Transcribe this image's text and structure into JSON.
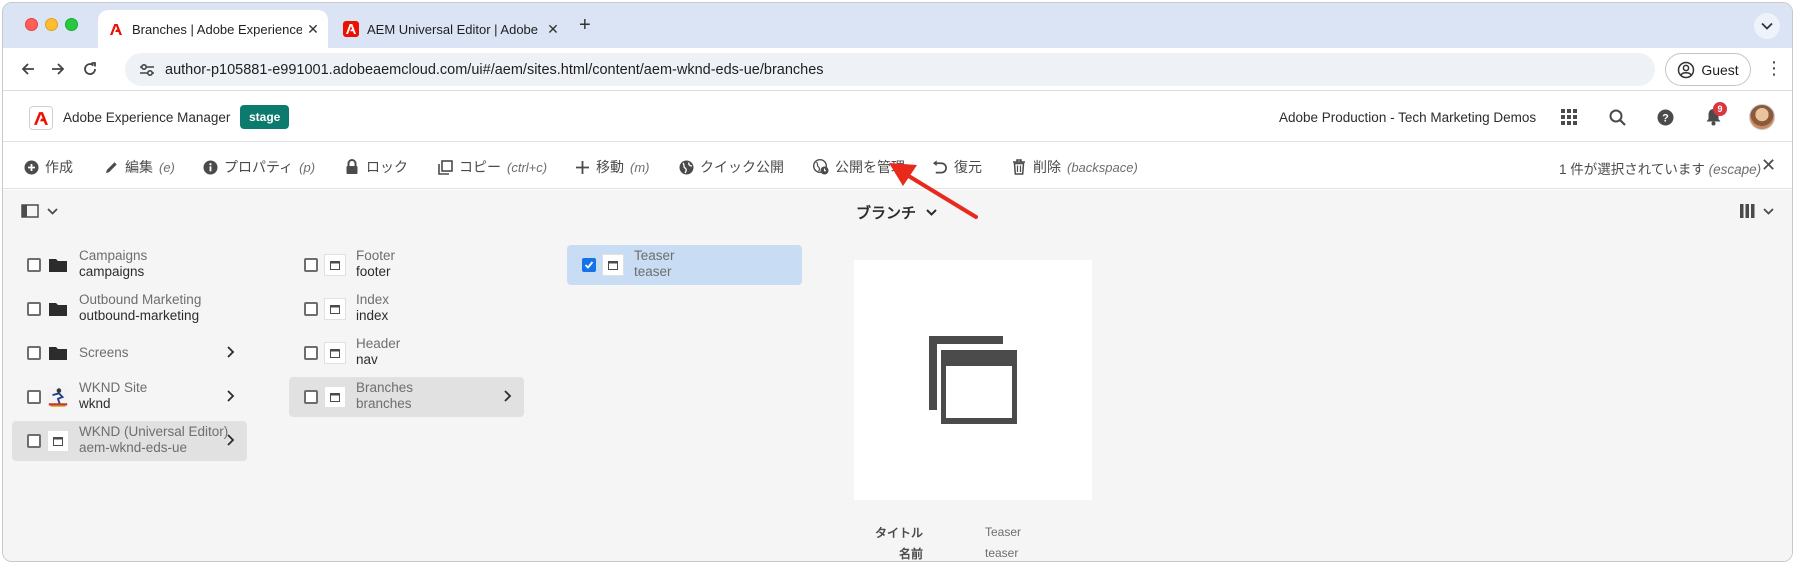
{
  "browser": {
    "tabs": [
      {
        "title": "Branches | Adobe Experience Manager",
        "active": true
      },
      {
        "title": "AEM Universal Editor | Adobe Experience Manager",
        "active": false
      }
    ],
    "url": "author-p105881-e991001.adobeaemcloud.com/ui#/aem/sites.html/content/aem-wknd-eds-ue/branches",
    "profile_label": "Guest"
  },
  "aem_header": {
    "app_name": "Adobe Experience Manager",
    "env_badge": "stage",
    "org_name": "Adobe Production - Tech Marketing Demos",
    "notification_count": "9"
  },
  "actions": [
    {
      "label": "作成",
      "shortcut": "",
      "icon": "plus-circle-icon"
    },
    {
      "label": "編集",
      "shortcut": "(e)",
      "icon": "pencil-icon"
    },
    {
      "label": "プロパティ",
      "shortcut": "(p)",
      "icon": "info-icon"
    },
    {
      "label": "ロック",
      "shortcut": "",
      "icon": "lock-icon"
    },
    {
      "label": "コピー",
      "shortcut": "(ctrl+c)",
      "icon": "copy-icon"
    },
    {
      "label": "移動",
      "shortcut": "(m)",
      "icon": "move-icon"
    },
    {
      "label": "クイック公開",
      "shortcut": "",
      "icon": "globe-icon"
    },
    {
      "label": "公開を管理",
      "shortcut": "",
      "icon": "globe-clock-icon"
    },
    {
      "label": "復元",
      "shortcut": "",
      "icon": "undo-icon"
    },
    {
      "label": "削除",
      "shortcut": "(backspace)",
      "icon": "trash-icon"
    }
  ],
  "selection": {
    "label": "1 件が選択されています",
    "shortcut": "(escape)"
  },
  "breadcrumb": {
    "label": "ブランチ"
  },
  "columns": [
    [
      {
        "title": "Campaigns",
        "name": "campaigns",
        "type": "folder",
        "has_children": false
      },
      {
        "title": "Outbound Marketing",
        "name": "outbound-marketing",
        "type": "folder",
        "has_children": false
      },
      {
        "title": "Screens",
        "name": "",
        "type": "folder",
        "has_children": true
      },
      {
        "title": "WKND Site",
        "name": "wknd",
        "type": "site",
        "has_children": true
      },
      {
        "title": "WKND (Universal Editor)",
        "name": "aem-wknd-eds-ue",
        "type": "page",
        "has_children": true,
        "in_path": true
      }
    ],
    [
      {
        "title": "Footer",
        "name": "footer",
        "type": "page",
        "has_children": false
      },
      {
        "title": "Index",
        "name": "index",
        "type": "page",
        "has_children": false
      },
      {
        "title": "Header",
        "name": "nav",
        "type": "page",
        "has_children": false
      },
      {
        "title": "Branches",
        "name": "branches",
        "type": "page",
        "has_children": true,
        "in_path": true
      }
    ],
    [
      {
        "title": "Teaser",
        "name": "teaser",
        "type": "page",
        "has_children": false,
        "checked": true
      }
    ]
  ],
  "preview": {
    "title_label": "タイトル",
    "title_value": "Teaser",
    "name_label": "名前",
    "name_value": "teaser"
  },
  "colors": {
    "accent": "#1473e6",
    "stage": "#0d7a6e",
    "annotation_arrow": "#e8291c"
  }
}
